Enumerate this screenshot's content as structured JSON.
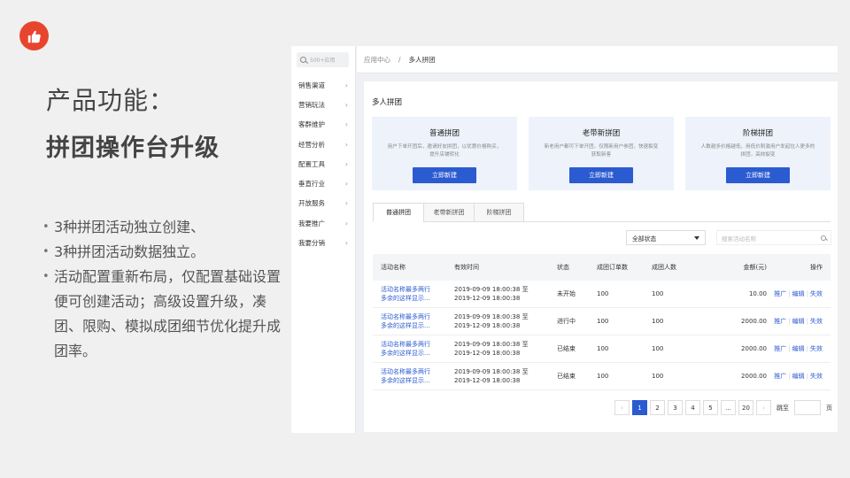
{
  "slide": {
    "heading": "产品功能：",
    "subheading": "拼团操作台升级",
    "bullets": [
      "3种拼团活动独立创建、",
      "3种拼团活动数据独立。",
      "活动配置重新布局，仅配置基础设置便可创建活动；高级设置升级，凑团、限购、模拟成团细节优化提升成团率。"
    ],
    "logo_icon": "thumbs-up-icon",
    "accent_color": "#e8452e"
  },
  "app": {
    "search_placeholder": "500+应用",
    "sidebar_items": [
      {
        "label": "销售渠道"
      },
      {
        "label": "营销玩法"
      },
      {
        "label": "客群维护"
      },
      {
        "label": "经营分析"
      },
      {
        "label": "配置工具"
      },
      {
        "label": "垂直行业"
      },
      {
        "label": "开放服务"
      },
      {
        "label": "我要推广"
      },
      {
        "label": "我要分销"
      }
    ],
    "breadcrumb": {
      "root": "应用中心",
      "separator": "/",
      "current": "多人拼团"
    },
    "page_title": "多人拼团",
    "cards": [
      {
        "title": "普通拼团",
        "desc": "用户下单开团后，邀请好友拼团，以优惠价格购买，提升店铺转化",
        "button": "立即新建"
      },
      {
        "title": "老带新拼团",
        "desc": "新老用户都可下单开团，仅限新用户参团，快速裂变获取新客",
        "button": "立即新建"
      },
      {
        "title": "阶梯拼团",
        "desc": "人数越多价格越低，用低价刺激用户发起拉人更多的拼团，高效裂变",
        "button": "立即新建"
      }
    ],
    "tabs": [
      "普通拼团",
      "老带新拼团",
      "阶梯拼团"
    ],
    "filter": {
      "status_value": "全部状态",
      "search_placeholder": "搜索活动名称"
    },
    "table": {
      "headers": [
        "活动名称",
        "有效时间",
        "状态",
        "成团订单数",
        "成团人数",
        "金额(元)",
        "操作"
      ],
      "rows": [
        {
          "name1": "活动名称最多两行",
          "name2": "多余的这样显示...",
          "time1": "2019-09-09 18:00:38 至",
          "time2": "2019-12-09 18:00:38",
          "status": "未开始",
          "orders": "100",
          "people": "100",
          "amount": "10.00"
        },
        {
          "name1": "活动名称最多两行",
          "name2": "多余的这样显示...",
          "time1": "2019-09-09 18:00:38 至",
          "time2": "2019-12-09 18:00:38",
          "status": "进行中",
          "orders": "100",
          "people": "100",
          "amount": "2000.00"
        },
        {
          "name1": "活动名称最多两行",
          "name2": "多余的这样显示...",
          "time1": "2019-09-09 18:00:38 至",
          "time2": "2019-12-09 18:00:38",
          "status": "已结束",
          "orders": "100",
          "people": "100",
          "amount": "2000.00"
        },
        {
          "name1": "活动名称最多两行",
          "name2": "多余的这样显示...",
          "time1": "2019-09-09 18:00:38 至",
          "time2": "2019-12-09 18:00:38",
          "status": "已结束",
          "orders": "100",
          "people": "100",
          "amount": "2000.00"
        }
      ],
      "ops": {
        "promote": "推广",
        "edit": "编辑",
        "invalidate": "失效",
        "separator": "|"
      }
    },
    "pagination": {
      "prev": "‹",
      "pages": [
        "1",
        "2",
        "3",
        "4",
        "5",
        "...",
        "20"
      ],
      "current": "1",
      "next": "›",
      "jump_label": "跳至",
      "page_label": "页"
    },
    "primary_color": "#2b5bd1"
  }
}
